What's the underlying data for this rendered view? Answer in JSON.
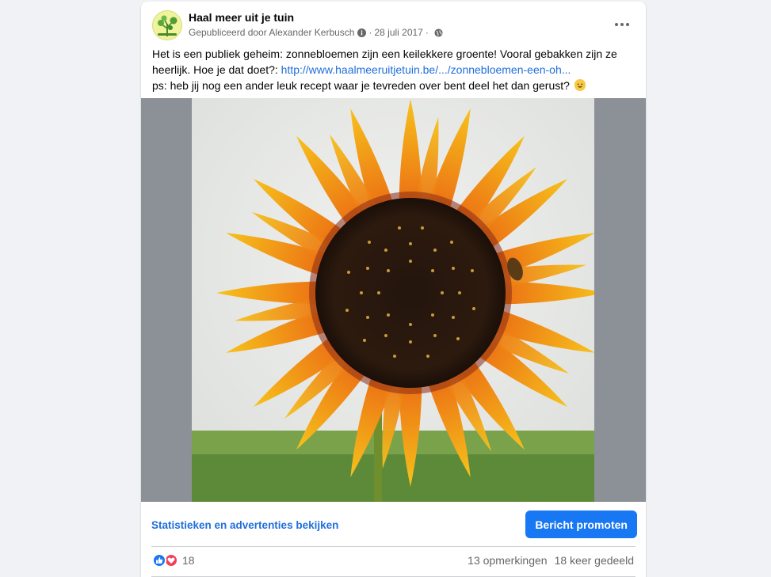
{
  "post": {
    "page_name": "Haal meer uit je tuin",
    "published_by": "Gepubliceerd door Alexander Kerbusch",
    "date": "28 juli 2017",
    "separator": "·",
    "text_line1": "Het is een publiek geheim: zonnebloemen zijn een keilekkere groente! Vooral gebakken zijn ze heerlijk. Hoe je dat doet?: ",
    "link": "http://www.haalmeeruitjetuin.be/.../zonnebloemen-een-oh...",
    "text_line2": "ps: heb jij nog een ander leuk recept waar je tevreden over bent deel het dan gerust?"
  },
  "insights": {
    "link_label": "Statistieken en advertenties bekijken",
    "promote_label": "Bericht promoten"
  },
  "stats": {
    "reaction_count": "18",
    "comments": "13 opmerkingen",
    "shares": "18 keer gedeeld"
  },
  "icons": {
    "reactions": [
      "like-icon",
      "love-icon"
    ],
    "emoji": "smiley-emoji",
    "meta": [
      "info-icon",
      "globe-icon"
    ]
  },
  "colors": {
    "link": "#216fdb",
    "primary_button": "#1877f2",
    "like": "#1877f2",
    "love": "#f33e58",
    "photo_letterbox": "#8c9097"
  }
}
